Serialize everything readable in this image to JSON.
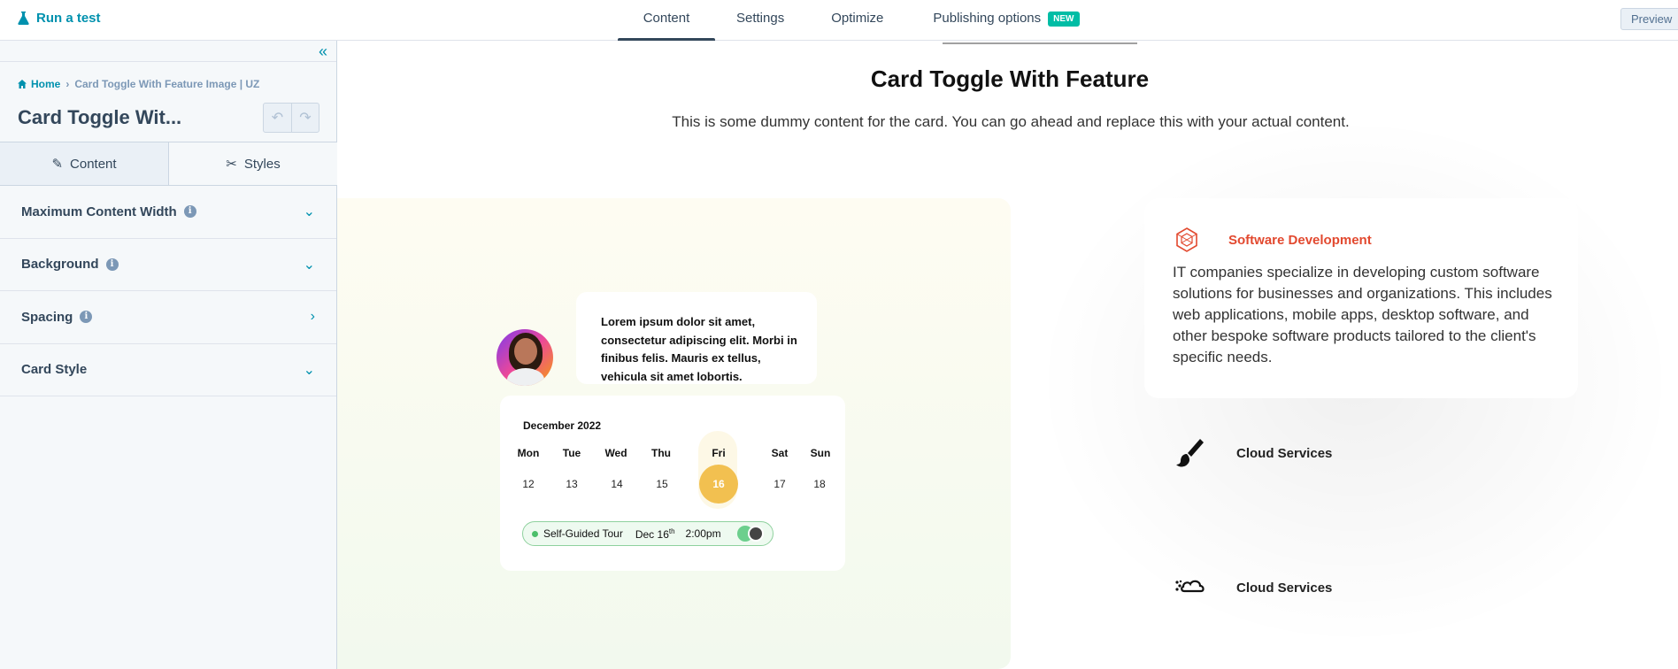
{
  "topbar": {
    "run_test": "Run a test",
    "tabs": [
      "Content",
      "Settings",
      "Optimize",
      "Publishing options"
    ],
    "new_badge": "NEW",
    "preview": "Preview"
  },
  "sidebar": {
    "breadcrumb_home": "Home",
    "breadcrumb_current": "Card Toggle With Feature Image | UZ",
    "module_title": "Card Toggle Wit...",
    "tabs": [
      "Content",
      "Styles"
    ],
    "sections": [
      {
        "label": "Maximum Content Width",
        "info": true,
        "chevron": "down"
      },
      {
        "label": "Background",
        "info": true,
        "chevron": "down"
      },
      {
        "label": "Spacing",
        "info": true,
        "chevron": "right"
      },
      {
        "label": "Card Style",
        "info": false,
        "chevron": "down"
      }
    ]
  },
  "canvas": {
    "title": "Card Toggle With Feature",
    "description": "This is some dummy content for the card. You can go ahead and replace this with your actual content.",
    "message": "Lorem ipsum dolor sit amet, consectetur adipiscing elit. Morbi in finibus felis. Mauris ex tellus, vehicula sit amet lobortis.",
    "calendar": {
      "month": "December 2022",
      "days": [
        "Mon",
        "Tue",
        "Wed",
        "Thu",
        "Fri",
        "Sat",
        "Sun"
      ],
      "dates": [
        "12",
        "13",
        "14",
        "15",
        "16",
        "17",
        "18"
      ],
      "selected_index": 4
    },
    "tour": {
      "label": "Self-Guided Tour",
      "date": "Dec 16",
      "date_suffix": "th",
      "time": "2:00pm"
    },
    "feature_card": {
      "heading": "Software Development",
      "text": "IT companies specialize in developing custom software solutions for businesses and organizations. This includes web applications, mobile apps, desktop software, and other bespoke software products tailored to the client's specific needs.",
      "accent": "#e2492f"
    },
    "services": [
      "Cloud Services",
      "Cloud Services"
    ]
  }
}
